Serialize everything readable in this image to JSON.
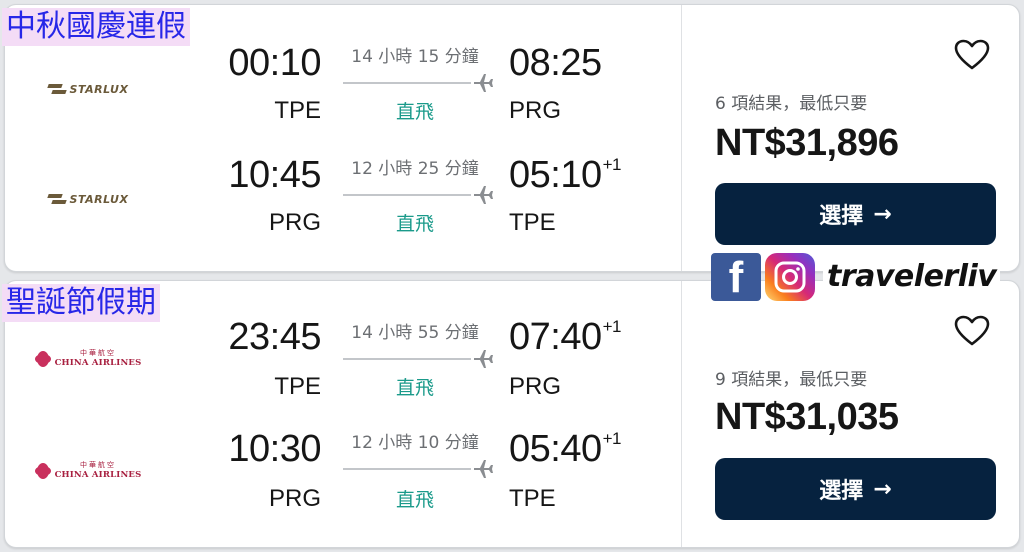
{
  "watermark": {
    "facebook_icon": "facebook-icon",
    "instagram_icon": "instagram-icon",
    "handle": "travelerliv"
  },
  "colors": {
    "tag_bg": "#f4dcf6",
    "tag_text": "#2727e8",
    "button_bg": "#06223f",
    "direct_text": "#1a9a8a"
  },
  "results": [
    {
      "tag": "中秋國慶連假",
      "legs": [
        {
          "airline": "STARLUX",
          "dep_time": "00:10",
          "dep_airport": "TPE",
          "duration": "14 小時 15 分鐘",
          "stops": "直飛",
          "arr_time": "08:25",
          "arr_offset": "",
          "arr_airport": "PRG"
        },
        {
          "airline": "STARLUX",
          "dep_time": "10:45",
          "dep_airport": "PRG",
          "duration": "12 小時 25 分鐘",
          "stops": "直飛",
          "arr_time": "05:10",
          "arr_offset": "+1",
          "arr_airport": "TPE"
        }
      ],
      "result_count": "6 項結果，最低只要",
      "price": "NT$31,896",
      "select_label": "選擇"
    },
    {
      "tag": "聖誕節假期",
      "legs": [
        {
          "airline_cn": "中華航空",
          "airline": "CHINA AIRLINES",
          "dep_time": "23:45",
          "dep_airport": "TPE",
          "duration": "14 小時 55 分鐘",
          "stops": "直飛",
          "arr_time": "07:40",
          "arr_offset": "+1",
          "arr_airport": "PRG"
        },
        {
          "airline_cn": "中華航空",
          "airline": "CHINA AIRLINES",
          "dep_time": "10:30",
          "dep_airport": "PRG",
          "duration": "12 小時 10 分鐘",
          "stops": "直飛",
          "arr_time": "05:40",
          "arr_offset": "+1",
          "arr_airport": "TPE"
        }
      ],
      "result_count": "9 項結果，最低只要",
      "price": "NT$31,035",
      "select_label": "選擇"
    }
  ]
}
